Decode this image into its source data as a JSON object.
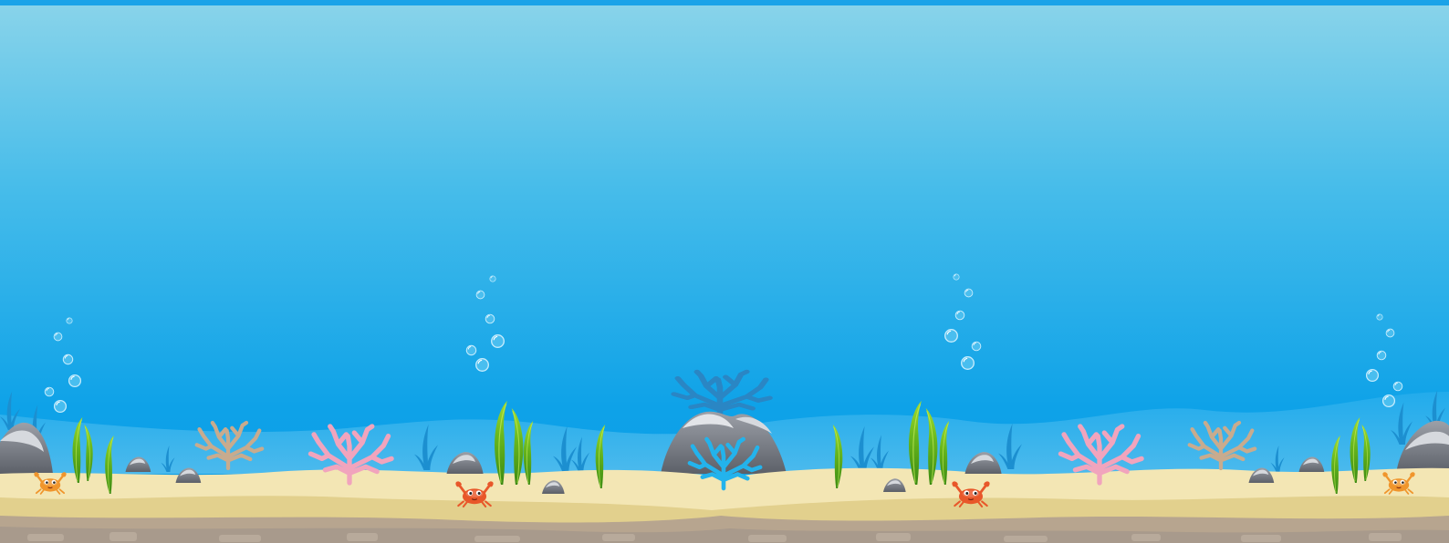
{
  "scene": {
    "name": "underwater-seabed-background",
    "colors": {
      "top_bar": "#1aa3e8",
      "water_top": "#8ad4ea",
      "water_bottom": "#0a9be6",
      "back_sand": "#bfe0f0",
      "far_plant": "#1c8fd0",
      "silhouette_coral": "#2a86c4",
      "sand_light": "#f3e6b4",
      "sand_mid": "#e2d08d",
      "bed_top": "#bfae95",
      "bed_rock": "#a89a8c",
      "rock_dark": "#6b6f78",
      "rock_light": "#d6d9de",
      "seaweed_dark": "#3f8e14",
      "seaweed_light": "#9bd42a",
      "coral_pink": "#f1a4bd",
      "coral_tan": "#c8ab8e",
      "coral_blue": "#23b3ec",
      "crab_red": "#e8572a",
      "crab_orange": "#f0952c",
      "bubble": "#d8f3ff"
    },
    "elements": {
      "bubble_columns": [
        "bubbles-far-left",
        "bubbles-center-left",
        "bubbles-center-right",
        "bubbles-far-right"
      ],
      "crabs": [
        "crab-orange-left",
        "crab-red-center-left",
        "crab-red-center-right",
        "crab-orange-right"
      ],
      "corals": [
        "coral-tan-left",
        "coral-pink-left",
        "coral-blue-center",
        "coral-pink-right",
        "coral-tan-right"
      ],
      "icons": [
        "bubble-icon",
        "crab-icon",
        "seaweed-icon",
        "coral-icon",
        "rock-icon"
      ]
    }
  }
}
